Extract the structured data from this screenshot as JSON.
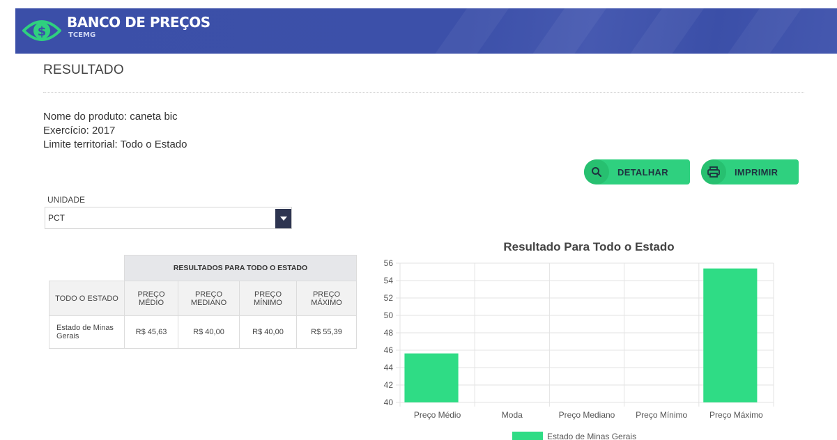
{
  "header": {
    "brand_title": "BANCO DE PREÇOS",
    "brand_subtitle": "TCEMG",
    "logo_icon": "dollar-eye-icon"
  },
  "page": {
    "title": "RESULTADO"
  },
  "info": {
    "produto": "Nome do produto: caneta bic",
    "exercicio": "Exercício: 2017",
    "limite": "Limite territorial: Todo o Estado"
  },
  "actions": {
    "detalhar_label": "DETALHAR",
    "detalhar_icon": "search-icon",
    "imprimir_label": "IMPRIMIR",
    "imprimir_icon": "printer-icon",
    "button_color": "#2fd07f"
  },
  "unidade": {
    "label": "UNIDADE",
    "selected": "PCT"
  },
  "table": {
    "group_header": "RESULTADOS PARA TODO O ESTADO",
    "columns": [
      "TODO O ESTADO",
      "PREÇO MÉDIO",
      "PREÇO MEDIANO",
      "PREÇO MÍNIMO",
      "PREÇO MÁXIMO"
    ],
    "rows": [
      [
        "Estado de Minas Gerais",
        "R$ 45,63",
        "R$ 40,00",
        "R$ 40,00",
        "R$ 55,39"
      ]
    ]
  },
  "chart_data": {
    "type": "bar",
    "title": "Resultado Para Todo o Estado",
    "categories": [
      "Preço Médio",
      "Moda",
      "Preço Mediano",
      "Preço Mínimo",
      "Preço Máximo"
    ],
    "series": [
      {
        "name": "Estado de Minas Gerais",
        "values": [
          45.63,
          0,
          40.0,
          40.0,
          55.39
        ],
        "color": "#2fdc85"
      }
    ],
    "ylim": [
      40,
      56
    ],
    "yticks": [
      40,
      42,
      44,
      46,
      48,
      50,
      52,
      54,
      56
    ],
    "grid": true,
    "legend": "bottom"
  }
}
